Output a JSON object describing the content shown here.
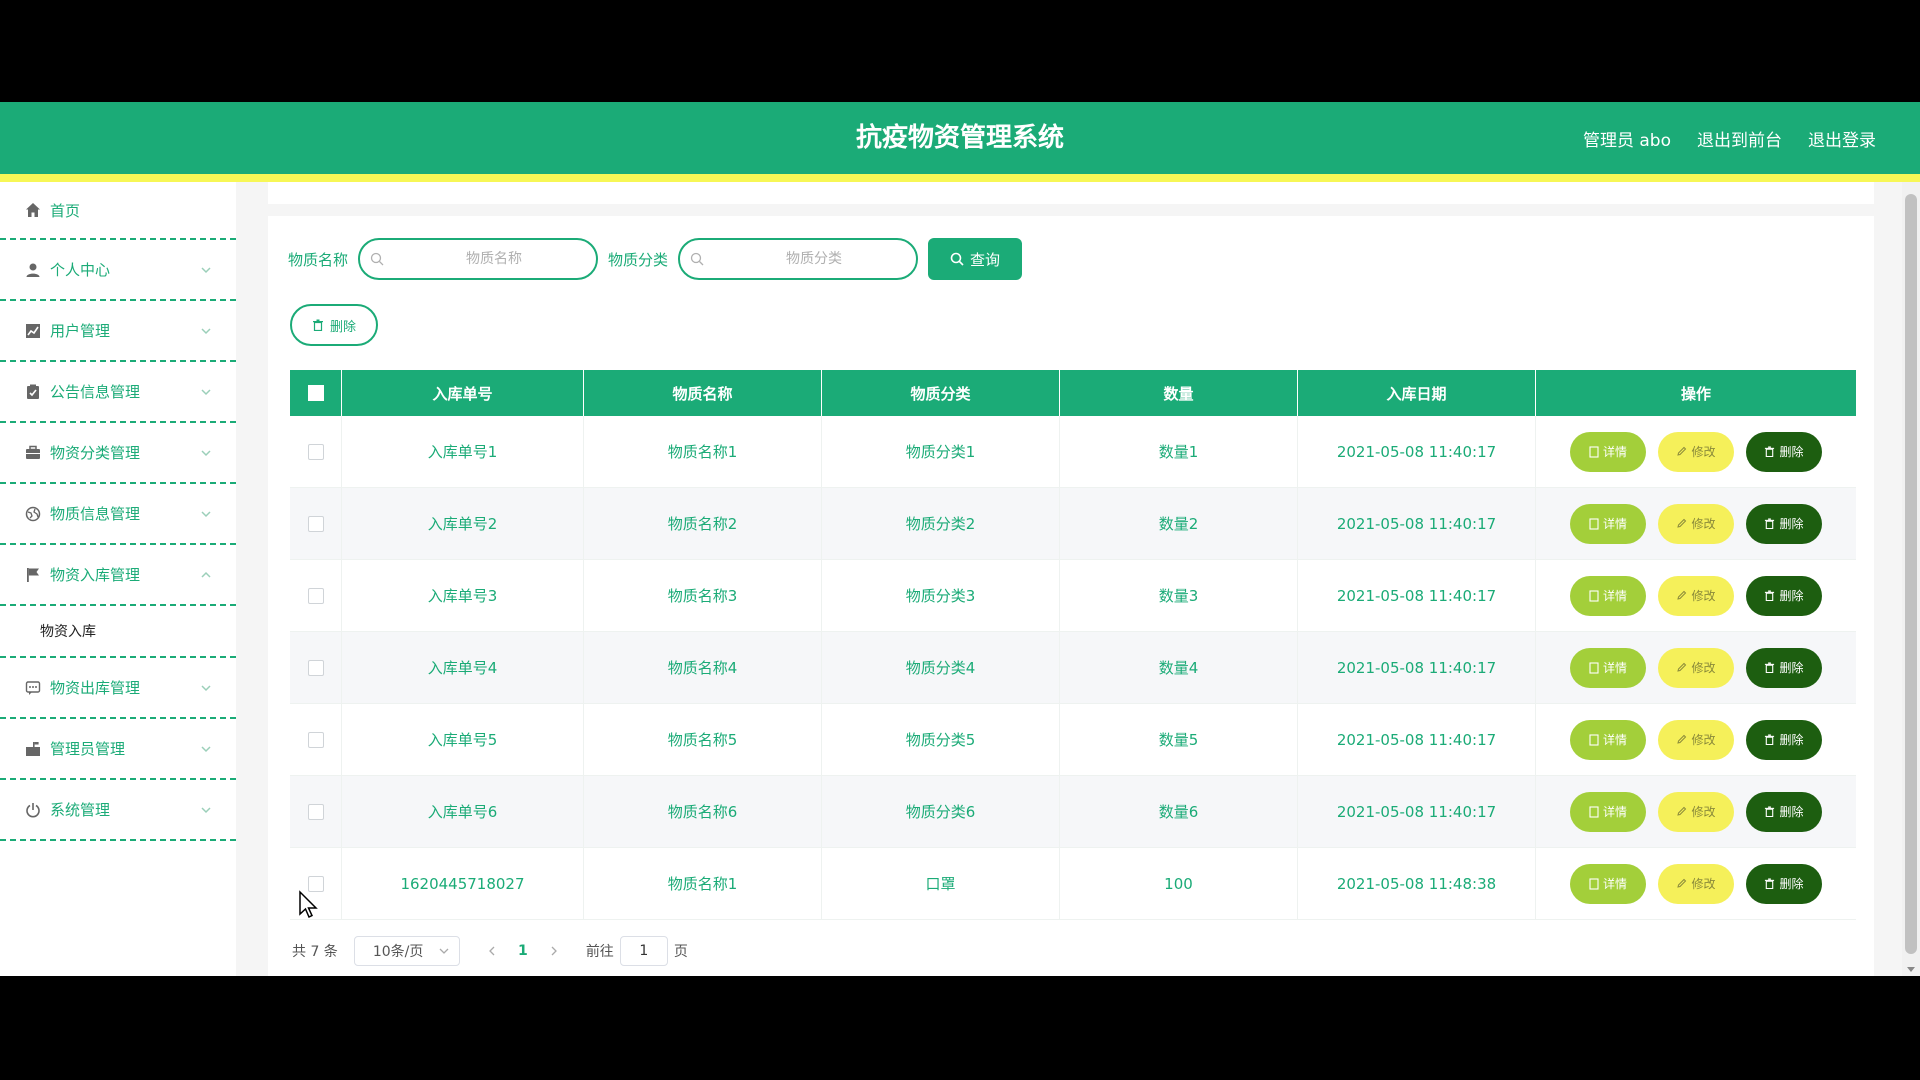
{
  "header": {
    "title": "抗疫物资管理系统",
    "user": "管理员 abo",
    "to_front": "退出到前台",
    "logout": "退出登录"
  },
  "sidebar": {
    "items": [
      {
        "label": "首页",
        "icon": "home-icon"
      },
      {
        "label": "个人中心",
        "icon": "user-icon"
      },
      {
        "label": "用户管理",
        "icon": "chart-icon"
      },
      {
        "label": "公告信息管理",
        "icon": "clipboard-icon"
      },
      {
        "label": "物资分类管理",
        "icon": "briefcase-icon"
      },
      {
        "label": "物质信息管理",
        "icon": "globe-icon"
      },
      {
        "label": "物资入库管理",
        "icon": "flag-icon"
      },
      {
        "label": "物资出库管理",
        "icon": "chat-icon"
      },
      {
        "label": "管理员管理",
        "icon": "mailbox-icon"
      },
      {
        "label": "系统管理",
        "icon": "power-icon"
      }
    ],
    "submenu": {
      "label": "物资入库"
    }
  },
  "search": {
    "name_label": "物质名称",
    "name_placeholder": "物质名称",
    "category_label": "物质分类",
    "category_placeholder": "物质分类",
    "query_label": "查询"
  },
  "toolbar": {
    "delete_label": "删除"
  },
  "table": {
    "columns": [
      "入库单号",
      "物质名称",
      "物质分类",
      "数量",
      "入库日期",
      "操作"
    ],
    "rows": [
      {
        "no": "入库单号1",
        "name": "物质名称1",
        "category": "物质分类1",
        "qty": "数量1",
        "date": "2021-05-08 11:40:17"
      },
      {
        "no": "入库单号2",
        "name": "物质名称2",
        "category": "物质分类2",
        "qty": "数量2",
        "date": "2021-05-08 11:40:17"
      },
      {
        "no": "入库单号3",
        "name": "物质名称3",
        "category": "物质分类3",
        "qty": "数量3",
        "date": "2021-05-08 11:40:17"
      },
      {
        "no": "入库单号4",
        "name": "物质名称4",
        "category": "物质分类4",
        "qty": "数量4",
        "date": "2021-05-08 11:40:17"
      },
      {
        "no": "入库单号5",
        "name": "物质名称5",
        "category": "物质分类5",
        "qty": "数量5",
        "date": "2021-05-08 11:40:17"
      },
      {
        "no": "入库单号6",
        "name": "物质名称6",
        "category": "物质分类6",
        "qty": "数量6",
        "date": "2021-05-08 11:40:17"
      },
      {
        "no": "1620445718027",
        "name": "物质名称1",
        "category": "口罩",
        "qty": "100",
        "date": "2021-05-08 11:48:38"
      }
    ],
    "actions": {
      "detail": "详情",
      "edit": "修改",
      "delete": "删除"
    }
  },
  "pager": {
    "total": "共 7 条",
    "page_size": "10条/页",
    "current_page": "1",
    "goto_prefix": "前往",
    "goto_value": "1",
    "goto_suffix": "页"
  },
  "colors": {
    "primary": "#1bab77",
    "stripe": "#f7f756",
    "detail_btn": "#a3cf3a",
    "edit_btn": "#f5f05a",
    "delete_btn": "#1d5e10"
  }
}
